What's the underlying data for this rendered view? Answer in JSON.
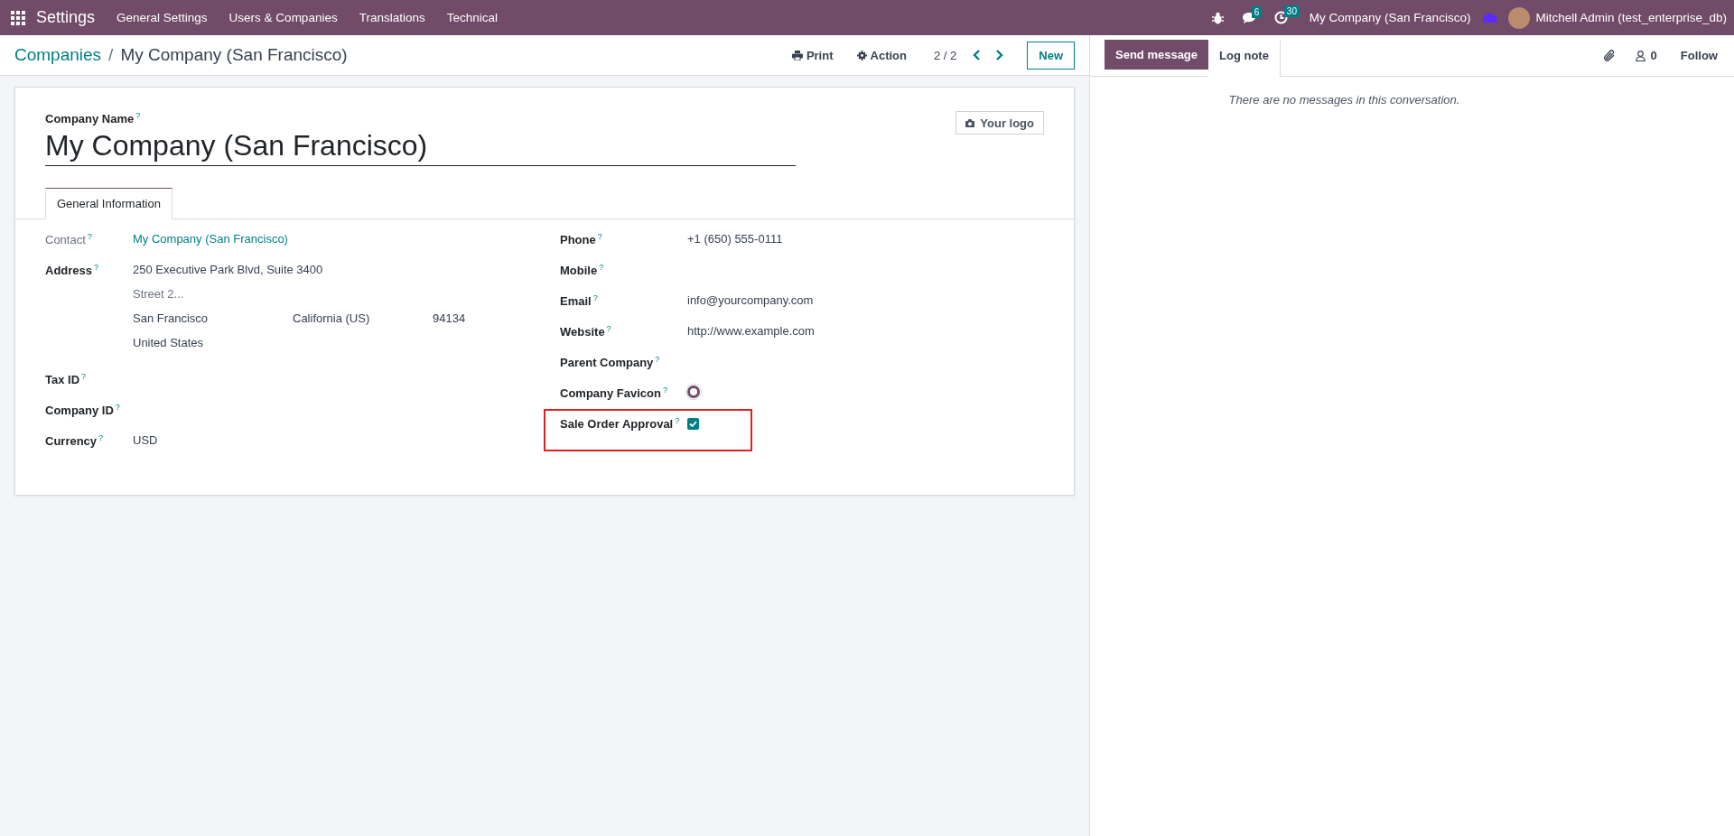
{
  "navbar": {
    "app": "Settings",
    "menus": [
      "General Settings",
      "Users & Companies",
      "Translations",
      "Technical"
    ],
    "messages_count": "6",
    "activities_count": "30",
    "company": "My Company (San Francisco)",
    "user": "Mitchell Admin (test_enterprise_db)"
  },
  "breadcrumb": {
    "parent": "Companies",
    "separator": "/",
    "current": "My Company (San Francisco)"
  },
  "actions": {
    "print": "Print",
    "action": "Action",
    "pager": "2 / 2",
    "new": "New"
  },
  "form": {
    "name_label": "Company Name",
    "name_help": "?",
    "name": "My Company (San Francisco)",
    "logo_button": "Your logo",
    "tabs": [
      {
        "label": "General Information",
        "selected": true
      }
    ],
    "left_fields": [
      {
        "kind": "link",
        "label": "Contact",
        "help": "?",
        "value": "My Company (San Francisco)"
      },
      {
        "kind": "address",
        "label": "Address",
        "help": "?",
        "street": "250 Executive Park Blvd, Suite 3400",
        "street2_placeholder": "Street 2...",
        "city": "San Francisco",
        "state": "California (US)",
        "zip": "94134",
        "country": "United States"
      },
      {
        "kind": "text",
        "label": "Tax ID",
        "help": "?"
      },
      {
        "kind": "text",
        "label": "Company ID",
        "help": "?"
      },
      {
        "kind": "text",
        "label": "Currency",
        "help": "?",
        "value": "USD"
      }
    ],
    "right_fields": [
      {
        "kind": "text",
        "label": "Phone",
        "help": "?",
        "value": "+1 (650) 555-0111"
      },
      {
        "kind": "text",
        "label": "Mobile",
        "help": "?"
      },
      {
        "kind": "text",
        "label": "Email",
        "help": "?",
        "value": "info@yourcompany.com"
      },
      {
        "kind": "text",
        "label": "Website",
        "help": "?",
        "value": "http://www.example.com"
      },
      {
        "kind": "text",
        "label": "Parent Company",
        "help": "?"
      },
      {
        "kind": "image",
        "label": "Company Favicon",
        "help": "?"
      },
      {
        "kind": "checkbox",
        "label": "Sale Order Approval",
        "help": "?",
        "checked": true,
        "highlighted": true
      }
    ]
  },
  "chatter": {
    "tabs": [
      {
        "label": "Send message",
        "selected": true
      },
      {
        "label": "Log note",
        "selected": false
      }
    ],
    "followers_count": "0",
    "follow": "Follow",
    "empty": "There are no messages in this conversation."
  }
}
